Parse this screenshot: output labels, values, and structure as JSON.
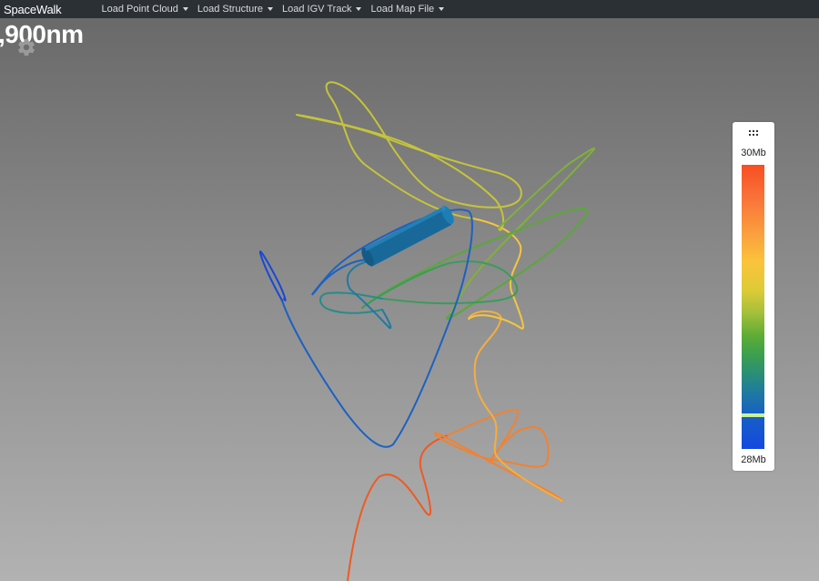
{
  "navbar": {
    "brand": "SpaceWalk",
    "menus": [
      {
        "label": "Load Point Cloud"
      },
      {
        "label": "Load Structure"
      },
      {
        "label": "Load IGV Track"
      },
      {
        "label": "Load Map File"
      }
    ]
  },
  "viewer": {
    "distance_readout": ",900nm",
    "settings_icon": "gear-icon",
    "background_top": "#676767",
    "background_bottom": "#b2b2b2"
  },
  "colorbar": {
    "handle_icon": "drag-handle-icon",
    "top_label": "30Mb",
    "bottom_label": "28Mb",
    "colors": [
      "#f84e21",
      "#fbc33c",
      "#5ead35",
      "#1f7aa0",
      "#1449e0"
    ],
    "marker_color": "#c9f39a"
  }
}
